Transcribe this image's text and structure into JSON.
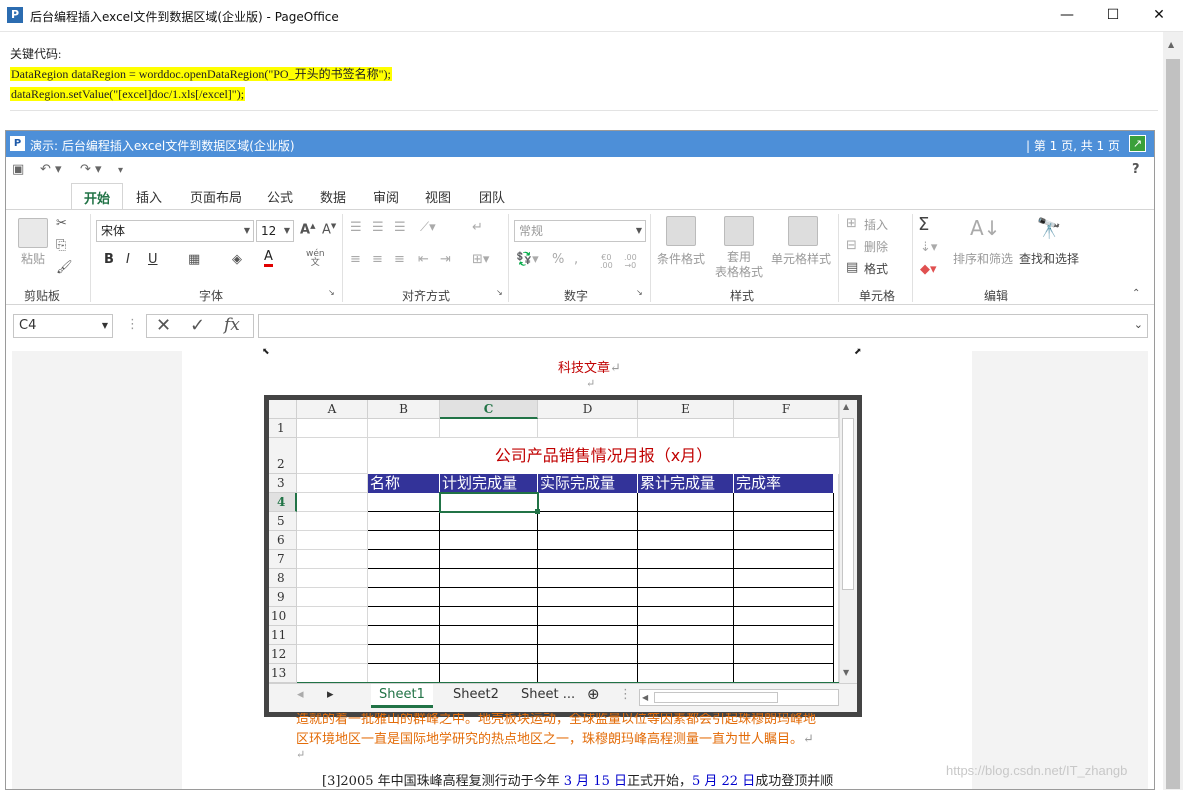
{
  "window": {
    "title": "后台编程插入excel文件到数据区域(企业版) - PageOffice",
    "app_icon": "P",
    "minimize": "—",
    "maximize": "☐",
    "close": "✕"
  },
  "code_section": {
    "label": "关键代码:",
    "lines": [
      "DataRegion dataRegion = worddoc.openDataRegion(\"PO_开头的书签名称\");",
      "dataRegion.setValue(\"[excel]doc/1.xls[/excel]\");"
    ],
    "highlight_color": "#ffff00"
  },
  "pageoffice": {
    "title": "演示: 后台编程插入excel文件到数据区域(企业版)",
    "page_info": "| 第 1 页, 共 1 页",
    "accent_color": "#4d8fd8"
  },
  "ribbon": {
    "tabs": [
      "开始",
      "插入",
      "页面布局",
      "公式",
      "数据",
      "审阅",
      "视图",
      "团队"
    ],
    "active_tab": "开始",
    "help": "?",
    "groups": {
      "clipboard": {
        "label": "剪贴板",
        "paste": "粘贴"
      },
      "font": {
        "label": "字体",
        "font_name": "宋体",
        "font_size": "12",
        "bold": "B",
        "italic": "I",
        "underline": "U",
        "grow": "A",
        "shrink": "A",
        "wen": "wén\n文"
      },
      "align": {
        "label": "对齐方式"
      },
      "number": {
        "label": "数字",
        "format": "常规",
        "percent": "%",
        "comma": ","
      },
      "styles": {
        "label": "样式",
        "cond": "条件格式",
        "table": "套用\n表格格式",
        "cell": "单元格样式"
      },
      "cells": {
        "label": "单元格",
        "insert": "插入",
        "delete": "删除",
        "format": "格式"
      },
      "editing": {
        "label": "编辑",
        "sort": "排序和筛选",
        "find": "查找和选择",
        "sum": "Σ"
      }
    }
  },
  "formula_bar": {
    "name_box": "C4",
    "cancel": "✕",
    "enter": "✓",
    "fx": "fx",
    "value": ""
  },
  "document": {
    "title": "科技文章",
    "para_mark": "↵",
    "paragraph_line1": "造就的着一批雅山的群峰之中。地壳板块运动，全球监量以位等因素都会引起珠穆朗玛峰地",
    "paragraph_line2": "区环境地区一直是国际地学研究的热点地区之一，珠穆朗玛峰高程测量一直为世人瞩目。",
    "paragraph_line3_prefix": "[3]2005 年中国珠峰高程复测行动于今年 ",
    "date1": "3 月 15 日",
    "mid": "正式开始，",
    "date2": "5 月 22 日",
    "suffix": "成功登顶并顺",
    "title_color": "#c00000",
    "para_color": "#e36c09",
    "date_color": "#0000cc"
  },
  "sheet": {
    "columns": [
      "A",
      "B",
      "C",
      "D",
      "E",
      "F"
    ],
    "selected_col": "C",
    "rows": [
      "1",
      "2",
      "3",
      "4",
      "5",
      "6",
      "7",
      "8",
      "9",
      "10",
      "11",
      "12",
      "13"
    ],
    "selected_row": "4",
    "report_title": "公司产品销售情况月报（x月）",
    "headers": [
      "名称",
      "计划完成量",
      "实际完成量",
      "累计完成量",
      "完成率"
    ],
    "header_bg": "#333399",
    "title_color": "#c00000",
    "tabs": [
      "Sheet1",
      "Sheet2",
      "Sheet ..."
    ],
    "active_tab": "Sheet1",
    "add_sheet": "⊕",
    "nav_prev": "◂",
    "nav_next": "▸"
  },
  "watermark": "https://blog.csdn.net/IT_zhangb"
}
